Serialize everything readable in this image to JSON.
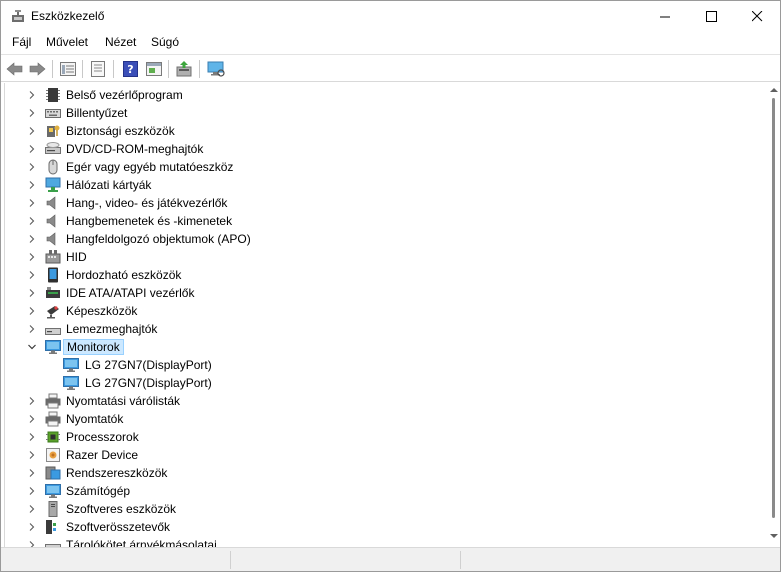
{
  "window": {
    "title": "Eszközkezelő"
  },
  "menu": [
    {
      "label": "Fájl"
    },
    {
      "label": "Művelet"
    },
    {
      "label": "Nézet"
    },
    {
      "label": "Súgó"
    }
  ],
  "tree": {
    "items": [
      {
        "label": "Belső vezérlőprogram",
        "icon": "firmware-icon"
      },
      {
        "label": "Billentyűzet",
        "icon": "keyboard-icon"
      },
      {
        "label": "Biztonsági eszközök",
        "icon": "security-key-icon"
      },
      {
        "label": "DVD/CD-ROM-meghajtók",
        "icon": "dvd-drive-icon"
      },
      {
        "label": "Egér vagy egyéb mutatóeszköz",
        "icon": "mouse-icon"
      },
      {
        "label": "Hálózati kártyák",
        "icon": "network-adapter-icon"
      },
      {
        "label": "Hang-, video- és játékvezérlők",
        "icon": "speaker-icon"
      },
      {
        "label": "Hangbemenetek és -kimenetek",
        "icon": "speaker-icon"
      },
      {
        "label": "Hangfeldolgozó objektumok (APO)",
        "icon": "speaker-icon"
      },
      {
        "label": "HID",
        "icon": "hid-icon"
      },
      {
        "label": "Hordozható eszközök",
        "icon": "portable-device-icon"
      },
      {
        "label": "IDE ATA/ATAPI vezérlők",
        "icon": "ide-controller-icon"
      },
      {
        "label": "Képeszközök",
        "icon": "camera-icon"
      },
      {
        "label": "Lemezmeghajtók",
        "icon": "disk-drive-icon"
      },
      {
        "label": "Monitorok",
        "icon": "monitor-icon",
        "expanded": true,
        "children": [
          {
            "label": "LG 27GN7(DisplayPort)",
            "icon": "monitor-icon"
          },
          {
            "label": "LG 27GN7(DisplayPort)",
            "icon": "monitor-icon"
          }
        ]
      },
      {
        "label": "Nyomtatási várólisták",
        "icon": "printer-icon"
      },
      {
        "label": "Nyomtatók",
        "icon": "printer-icon"
      },
      {
        "label": "Processzorok",
        "icon": "cpu-icon"
      },
      {
        "label": "Razer Device",
        "icon": "razer-device-icon"
      },
      {
        "label": "Rendszereszközök",
        "icon": "system-device-icon"
      },
      {
        "label": "Számítógép",
        "icon": "computer-icon"
      },
      {
        "label": "Szoftveres eszközök",
        "icon": "software-device-icon"
      },
      {
        "label": "Szoftverösszetevők",
        "icon": "software-component-icon"
      },
      {
        "label": "Tárolókötet árnyékmásolatai",
        "icon": "storage-volume-icon"
      }
    ]
  },
  "colors": {
    "selection_bg": "#cce8ff",
    "selection_border": "#99d1ff",
    "monitor_blue": "#3b9ae1"
  }
}
